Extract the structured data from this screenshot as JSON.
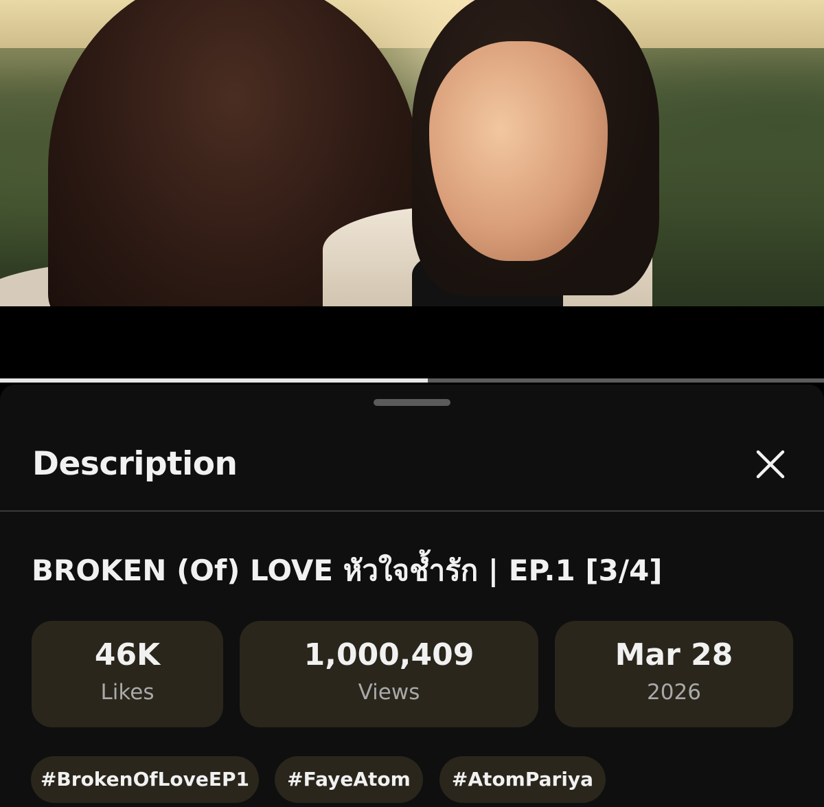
{
  "player": {
    "progress_fraction": 0.519
  },
  "sheet": {
    "title": "Description",
    "close_icon": "close-icon"
  },
  "video": {
    "title": "BROKEN (Of) LOVE หัวใจช้ำรัก | EP.1 [3/4]"
  },
  "stats": {
    "likes": {
      "value": "46K",
      "label": "Likes"
    },
    "views": {
      "value": "1,000,409",
      "label": "Views"
    },
    "date": {
      "value": "Mar 28",
      "label": "2026"
    }
  },
  "hashtags": [
    "#BrokenOfLoveEP1",
    "#FayeAtom",
    "#AtomPariya"
  ],
  "colors": {
    "sheet_bg": "#0f0f0f",
    "chip_bg": "#2a261c",
    "text_primary": "#f1f1f1",
    "text_secondary": "#a9a9a9",
    "progress_played": "#e7e7e7",
    "progress_track": "#5c5c5c"
  }
}
